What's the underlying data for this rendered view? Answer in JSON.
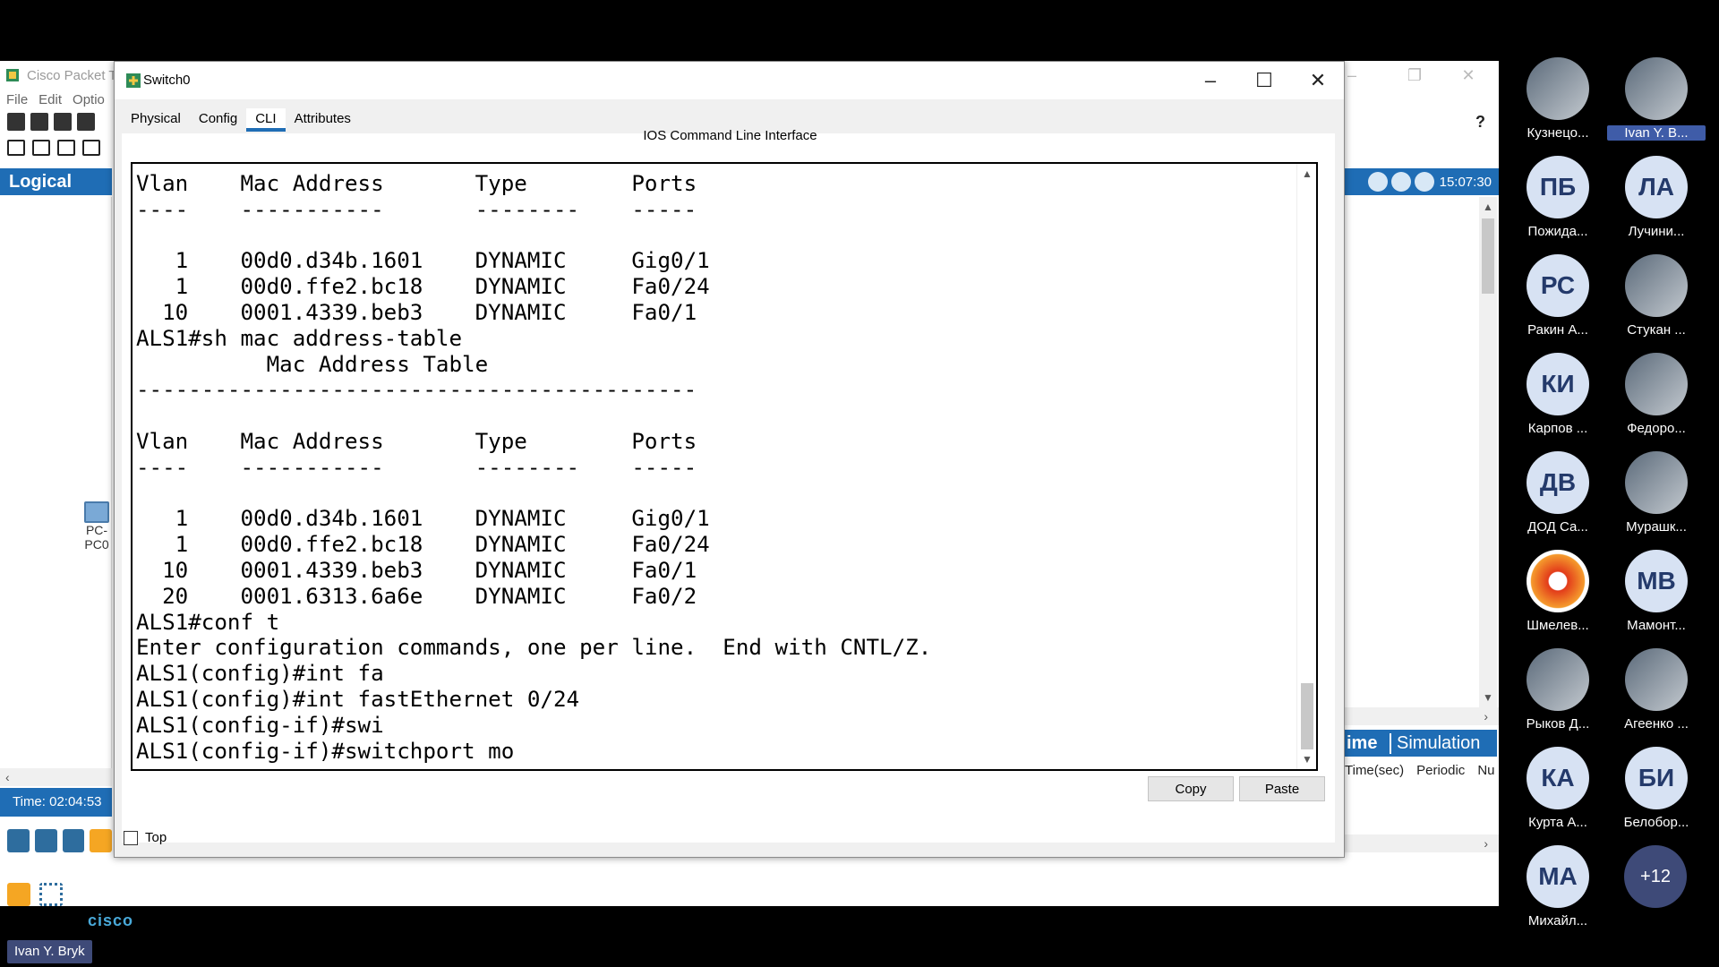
{
  "app": {
    "title": "Cisco Packet Tr",
    "menu": [
      "File",
      "Edit",
      "Optio"
    ],
    "logical_label": "Logical",
    "time_label": "Time: 02:04:53",
    "clock": "15:07:30",
    "help": "?",
    "pc_device": {
      "line1": "PC-",
      "line2": "PC0"
    },
    "realtime_label": "ime",
    "simulation_label": "Simulation",
    "scenario_cols": [
      "Time(sec)",
      "Periodic",
      "Nu"
    ],
    "logo_text": "cisco",
    "colors": {
      "accent": "#1f6db5",
      "tile": "#3e4a78"
    }
  },
  "dialog": {
    "title": "Switch0",
    "tabs": [
      {
        "label": "Physical",
        "active": false
      },
      {
        "label": "Config",
        "active": false
      },
      {
        "label": "CLI",
        "active": true
      },
      {
        "label": "Attributes",
        "active": false
      }
    ],
    "caption": "IOS Command Line Interface",
    "terminal_lines": [
      "Vlan    Mac Address       Type        Ports",
      "----    -----------       --------    -----",
      "",
      "   1    00d0.d34b.1601    DYNAMIC     Gig0/1",
      "   1    00d0.ffe2.bc18    DYNAMIC     Fa0/24",
      "  10    0001.4339.beb3    DYNAMIC     Fa0/1",
      "ALS1#sh mac address-table",
      "          Mac Address Table",
      "-------------------------------------------",
      "",
      "Vlan    Mac Address       Type        Ports",
      "----    -----------       --------    -----",
      "",
      "   1    00d0.d34b.1601    DYNAMIC     Gig0/1",
      "   1    00d0.ffe2.bc18    DYNAMIC     Fa0/24",
      "  10    0001.4339.beb3    DYNAMIC     Fa0/1",
      "  20    0001.6313.6a6e    DYNAMIC     Fa0/2",
      "ALS1#conf t",
      "Enter configuration commands, one per line.  End with CNTL/Z.",
      "ALS1(config)#int fa",
      "ALS1(config)#int fastEthernet 0/24",
      "ALS1(config-if)#swi",
      "ALS1(config-if)#switchport mo"
    ],
    "copy_label": "Copy",
    "paste_label": "Paste",
    "top_label": "Top"
  },
  "participants": [
    {
      "name": "Кузнецо...",
      "initials": "",
      "kind": "photo"
    },
    {
      "name": "Ivan Y. B...",
      "initials": "",
      "kind": "photo",
      "highlight": true
    },
    {
      "name": "Пожида...",
      "initials": "ПБ",
      "kind": "txt"
    },
    {
      "name": "Лучини...",
      "initials": "ЛА",
      "kind": "txt"
    },
    {
      "name": "Ракин А...",
      "initials": "РС",
      "kind": "txt"
    },
    {
      "name": "Стукан ...",
      "initials": "",
      "kind": "photo"
    },
    {
      "name": "Карпов ...",
      "initials": "КИ",
      "kind": "txt"
    },
    {
      "name": "Федоро...",
      "initials": "",
      "kind": "photo"
    },
    {
      "name": "ДОД Са...",
      "initials": "ДВ",
      "kind": "txt"
    },
    {
      "name": "Мурашк...",
      "initials": "",
      "kind": "photo"
    },
    {
      "name": "Шмелев...",
      "initials": "",
      "kind": "fire"
    },
    {
      "name": "Мамонт...",
      "initials": "МВ",
      "kind": "txt"
    },
    {
      "name": "Рыков Д...",
      "initials": "",
      "kind": "photo"
    },
    {
      "name": "Агеенко ...",
      "initials": "",
      "kind": "photo"
    },
    {
      "name": "Курта А...",
      "initials": "КА",
      "kind": "txt"
    },
    {
      "name": "Белобор...",
      "initials": "БИ",
      "kind": "txt"
    },
    {
      "name": "Михайл...",
      "initials": "МА",
      "kind": "txt"
    }
  ],
  "more_count": "+12",
  "speaker": "Ivan Y. Bryk"
}
